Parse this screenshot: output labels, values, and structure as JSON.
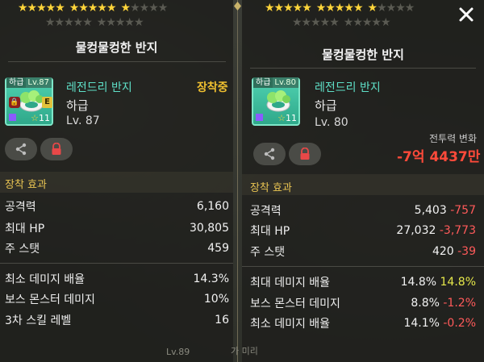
{
  "left": {
    "stars": {
      "filled": 11,
      "total": 15,
      "second_row_total": 10
    },
    "title": "물컹물컹한 반지",
    "icon": {
      "tag_grade": "하급",
      "tag_level": "Lv.87",
      "star_count": "11",
      "e_badge": "E"
    },
    "item_name": "레전드리 반지",
    "equipped": "장착중",
    "grade": "하급",
    "level": "Lv. 87",
    "section_title": "장착 효과",
    "stats": [
      {
        "label": "공격력",
        "value": "6,160"
      },
      {
        "label": "최대 HP",
        "value": "30,805"
      },
      {
        "label": "주 스탯",
        "value": "459"
      }
    ],
    "extra_stats": [
      {
        "label": "최소 데미지 배율",
        "value": "14.3%"
      },
      {
        "label": "보스 몬스터 데미지",
        "value": "10%"
      },
      {
        "label": "3차 스킬 레벨",
        "value": "16"
      }
    ],
    "bottom_level": "Lv.89"
  },
  "right": {
    "stars": {
      "filled": 11,
      "total": 15,
      "second_row_total": 10
    },
    "title": "물컹물컹한 반지",
    "icon": {
      "tag_grade": "하급",
      "tag_level": "Lv.80",
      "star_count": "11"
    },
    "item_name": "레전드리 반지",
    "grade": "하급",
    "level": "Lv. 80",
    "power_label": "전투력 변화",
    "power_value": "-7억 4437만",
    "section_title": "장착 효과",
    "stats": [
      {
        "label": "공격력",
        "value": "5,403",
        "diff": "-757",
        "diff_type": "neg"
      },
      {
        "label": "최대 HP",
        "value": "27,032",
        "diff": "-3,773",
        "diff_type": "neg"
      },
      {
        "label": "주 스탯",
        "value": "420",
        "diff": "-39",
        "diff_type": "neg"
      }
    ],
    "extra_stats": [
      {
        "label": "최대 데미지 배율",
        "value": "14.8%",
        "diff": "14.8%",
        "diff_type": "pos"
      },
      {
        "label": "보스 몬스터 데미지",
        "value": "8.8%",
        "diff": "-1.2%",
        "diff_type": "neg"
      },
      {
        "label": "최소 데미지 배율",
        "value": "14.1%",
        "diff": "-0.2%",
        "diff_type": "neg"
      }
    ],
    "bottom_text": "가 미리"
  },
  "colors": {
    "star_on": "#ffd53a",
    "item_name": "#5fe0c8",
    "equipped": "#f0c030",
    "section": "#e9c452",
    "negative": "#ff5a5a",
    "positive": "#e6e84a"
  },
  "icons": [
    "share-icon",
    "lock-icon",
    "close-icon",
    "star-icon",
    "ring-icon"
  ]
}
